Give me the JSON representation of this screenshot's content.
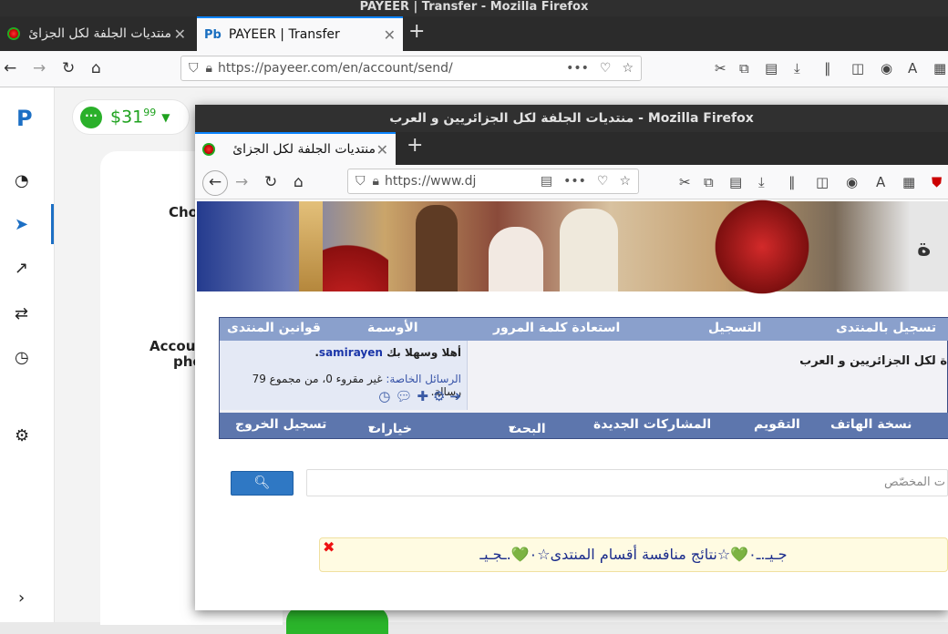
{
  "outer_window": {
    "title": "PAYEER | Transfer - Mozilla Firefox",
    "tabs": [
      {
        "label": "منتديات الجلفة لكل الجزائ",
        "active": false
      },
      {
        "label": "PAYEER | Transfer",
        "active": true
      }
    ],
    "url": "https://payeer.com/en/account/send/"
  },
  "payeer": {
    "balance_main": "$31",
    "balance_cents": "99",
    "text_cho": "Cho",
    "text_accou": "Accou",
    "text_pho": "pho"
  },
  "inner_window": {
    "title": "منتديات الجلفة لكل الجزائريين و العرب - Mozilla Firefox",
    "tab_label": "منتديات الجلفة لكل الجزائ",
    "url": "https://www.dj"
  },
  "forum": {
    "menu_top": [
      "قوانين المنتدى",
      "الأوسمة",
      "استعادة كلمة المرور",
      "التسجيل",
      "تسجيل بالمنتدى"
    ],
    "welcome_prefix": "أهلا وسهلا بك",
    "username": "samirayen",
    "messages_label": "الرسائل الخاصة:",
    "messages_text": "غير مقروء 0، من مجموع 79 رسالة.",
    "site_title": "ة لكل الجزائريين و العرب",
    "menu_bottom": [
      "تسجيل الخروج",
      "خيارات سريعة",
      "البحث",
      "المشاركات الجديدة",
      "التقويم",
      "نسخة الهاتف"
    ],
    "search_placeholder": "ت المخصّص",
    "notice": "جـيـ.ـ۰💚☆نتائج منافسة أقسام المنتدى☆۰💚.ـجـيـ"
  }
}
